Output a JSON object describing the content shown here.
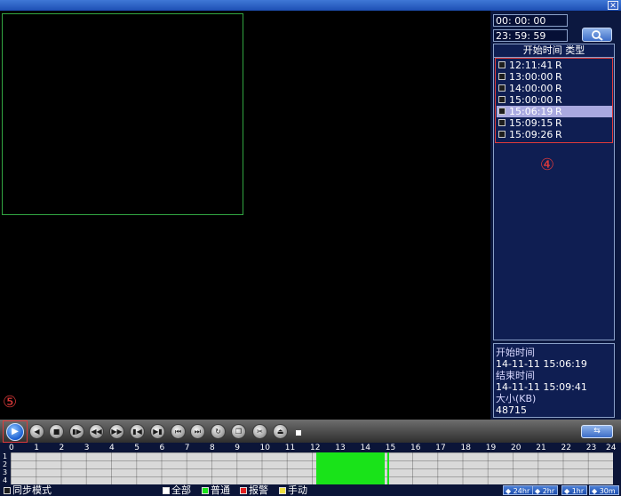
{
  "window": {
    "close_icon": "close-icon"
  },
  "search": {
    "start_time": "00: 00: 00",
    "end_time": "23: 59: 59",
    "search_icon": "magnifier-icon"
  },
  "file_list": {
    "header": "开始时间 类型",
    "items": [
      {
        "time": "12:11:41",
        "type": "R",
        "selected": false
      },
      {
        "time": "13:00:00",
        "type": "R",
        "selected": false
      },
      {
        "time": "14:00:00",
        "type": "R",
        "selected": false
      },
      {
        "time": "15:00:00",
        "type": "R",
        "selected": false
      },
      {
        "time": "15:06:19",
        "type": "R",
        "selected": true
      },
      {
        "time": "15:09:15",
        "type": "R",
        "selected": false
      },
      {
        "time": "15:09:26",
        "type": "R",
        "selected": false
      }
    ]
  },
  "annotations": {
    "marker_4": "④",
    "marker_5": "⑤"
  },
  "info": {
    "start_label": "开始时间",
    "start_value": "14-11-11 15:06:19",
    "end_label": "结束时间",
    "end_value": "14-11-11 15:09:41",
    "size_label": "大小(KB)",
    "size_value": "48715"
  },
  "toolbar": {
    "buttons": [
      "play",
      "reverse-play",
      "stop",
      "slow",
      "fast-rewind",
      "fast-forward",
      "prev-frame",
      "next-frame",
      "prev-file",
      "next-file",
      "loop",
      "fullscreen",
      "clip",
      "backup"
    ]
  },
  "timeline": {
    "hours": [
      "0",
      "1",
      "2",
      "3",
      "4",
      "5",
      "6",
      "7",
      "8",
      "9",
      "10",
      "11",
      "12",
      "13",
      "14",
      "15",
      "16",
      "17",
      "18",
      "19",
      "20",
      "21",
      "22",
      "23",
      "24"
    ],
    "channels": [
      "1",
      "2",
      "3",
      "4"
    ],
    "recording": {
      "start_hour": 12.18,
      "end_hour": 15.09,
      "color": "#19e319"
    }
  },
  "bottom": {
    "sync_mode": "同步模式",
    "filters": [
      {
        "label": "全部",
        "color": "#ffffff"
      },
      {
        "label": "普通",
        "color": "#19e319"
      },
      {
        "label": "报警",
        "color": "#e32020"
      },
      {
        "label": "手动",
        "color": "#f0e040"
      }
    ],
    "zoom": [
      "24hr",
      "2hr",
      "1hr",
      "30m"
    ]
  }
}
